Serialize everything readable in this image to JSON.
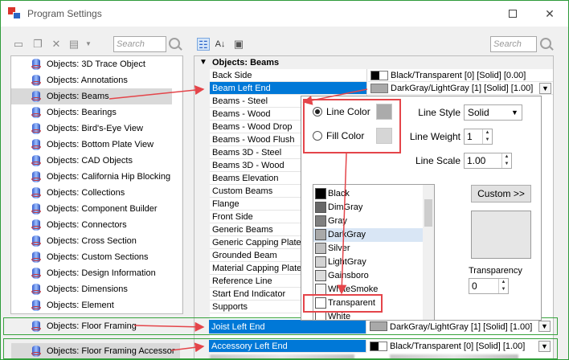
{
  "window": {
    "title": "Program Settings"
  },
  "colors": {
    "selection": "#0078d7",
    "annotation_red": "#e4454a",
    "annotation_green": "#36a23c"
  },
  "toolbar_left": {
    "search_placeholder": "Search"
  },
  "toolbar_right": {
    "search_placeholder": "Search"
  },
  "left_list": {
    "items": [
      "Objects: 3D Trace Object",
      "Objects: Annotations",
      "Objects: Beams",
      "Objects: Bearings",
      "Objects: Bird's-Eye View",
      "Objects: Bottom Plate View",
      "Objects: CAD Objects",
      "Objects: California Hip Blocking",
      "Objects: Collections",
      "Objects: Component Builder",
      "Objects: Connectors",
      "Objects: Cross Section",
      "Objects: Custom Sections",
      "Objects: Design Information",
      "Objects: Dimensions",
      "Objects: Element"
    ],
    "selected_index": 2,
    "floor_framing": "Objects: Floor Framing",
    "floor_framing_accessories": "Objects: Floor Framing Accessor"
  },
  "grid": {
    "category": "Objects: Beams",
    "properties": [
      {
        "name": "Back Side",
        "value": "Black/Transparent [0] [Solid] [0.00]"
      },
      {
        "name": "Beam Left End",
        "value": "DarkGray/LightGray [1] [Solid] [1.00]"
      },
      {
        "name": "Beams - Steel"
      },
      {
        "name": "Beams - Wood"
      },
      {
        "name": "Beams - Wood Drop"
      },
      {
        "name": "Beams - Wood Flush"
      },
      {
        "name": "Beams 3D - Steel"
      },
      {
        "name": "Beams 3D - Wood"
      },
      {
        "name": "Beams Elevation"
      },
      {
        "name": "Custom Beams"
      },
      {
        "name": "Flange"
      },
      {
        "name": "Front Side"
      },
      {
        "name": "Generic Beams"
      },
      {
        "name": "Generic Capping Plate"
      },
      {
        "name": "Grounded Beam"
      },
      {
        "name": "Material Capping Plate"
      },
      {
        "name": "Reference Line"
      },
      {
        "name": "Start End Indicator"
      },
      {
        "name": "Supports"
      }
    ],
    "joist_left_end": {
      "name": "Joist Left End",
      "value": "DarkGray/LightGray [1] [Solid] [1.00]"
    },
    "accessory_left_end": {
      "name": "Accessory Left End",
      "value": "Black/Transparent [0] [Solid] [1.00]"
    }
  },
  "editor": {
    "line_color_label": "Line Color",
    "fill_color_label": "Fill Color",
    "line_style_label": "Line Style",
    "line_style_value": "Solid",
    "line_weight_label": "Line Weight",
    "line_weight_value": "1",
    "line_scale_label": "Line Scale",
    "line_scale_value": "1.00",
    "custom_button": "Custom >>",
    "transparency_label": "Transparency",
    "transparency_value": "0",
    "color_list": [
      {
        "name": "Black",
        "color": "#000000"
      },
      {
        "name": "DimGray",
        "color": "#696969"
      },
      {
        "name": "Gray",
        "color": "#808080"
      },
      {
        "name": "DarkGray",
        "color": "#a9a9a9"
      },
      {
        "name": "Silver",
        "color": "#c0c0c0"
      },
      {
        "name": "LightGray",
        "color": "#d3d3d3"
      },
      {
        "name": "Gainsboro",
        "color": "#dcdcdc"
      },
      {
        "name": "WhiteSmoke",
        "color": "#f5f5f5"
      },
      {
        "name": "Transparent",
        "color": "#ffffff"
      },
      {
        "name": "White",
        "color": "#ffffff"
      }
    ],
    "highlighted_color_index": 3
  }
}
